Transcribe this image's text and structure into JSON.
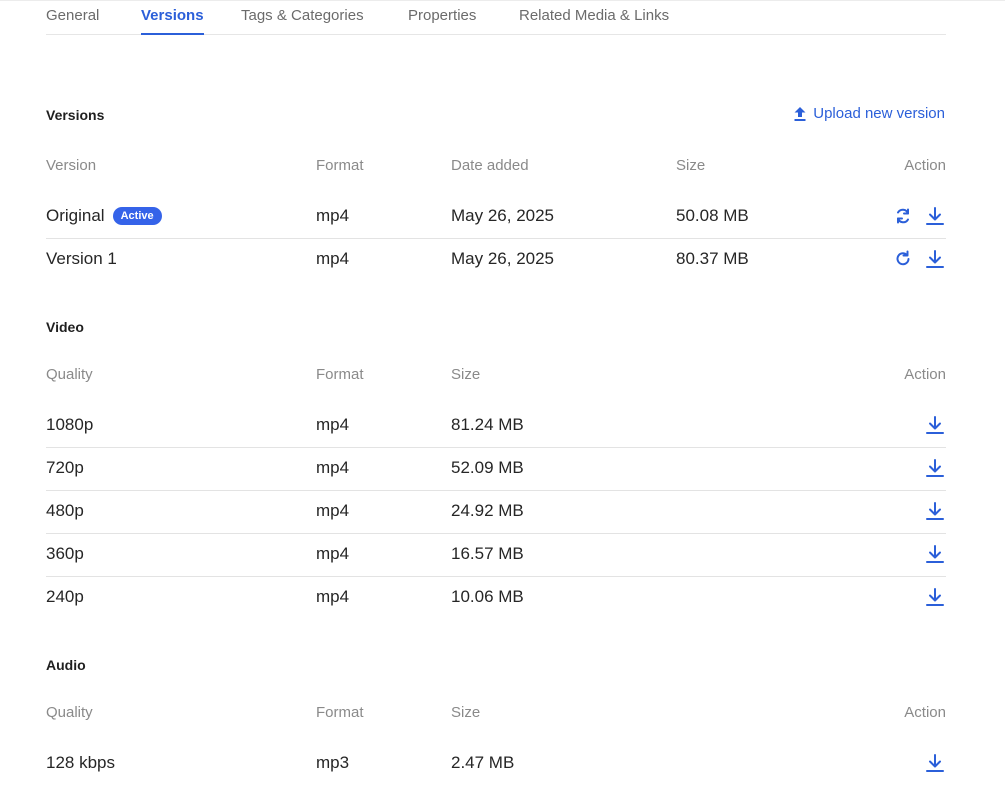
{
  "tabs": [
    "General",
    "Versions",
    "Tags & Categories",
    "Properties",
    "Related Media & Links"
  ],
  "active_tab": "Versions",
  "versions": {
    "title": "Versions",
    "upload_label": "Upload new version",
    "headers": {
      "version": "Version",
      "format": "Format",
      "date": "Date added",
      "size": "Size",
      "action": "Action"
    },
    "active_badge": "Active",
    "rows": [
      {
        "name": "Original",
        "format": "mp4",
        "date": "May 26, 2025",
        "size": "50.08 MB",
        "active": true
      },
      {
        "name": "Version 1",
        "format": "mp4",
        "date": "May 26, 2025",
        "size": "80.37 MB",
        "active": false
      }
    ]
  },
  "video": {
    "title": "Video",
    "headers": {
      "quality": "Quality",
      "format": "Format",
      "size": "Size",
      "action": "Action"
    },
    "rows": [
      {
        "quality": "1080p",
        "format": "mp4",
        "size": "81.24 MB"
      },
      {
        "quality": "720p",
        "format": "mp4",
        "size": "52.09 MB"
      },
      {
        "quality": "480p",
        "format": "mp4",
        "size": "24.92 MB"
      },
      {
        "quality": "360p",
        "format": "mp4",
        "size": "16.57 MB"
      },
      {
        "quality": "240p",
        "format": "mp4",
        "size": "10.06 MB"
      }
    ]
  },
  "audio": {
    "title": "Audio",
    "headers": {
      "quality": "Quality",
      "format": "Format",
      "size": "Size",
      "action": "Action"
    },
    "rows": [
      {
        "quality": "128 kbps",
        "format": "mp3",
        "size": "2.47 MB"
      }
    ]
  },
  "colors": {
    "accent": "#2b5fd9",
    "badge": "#3563e9"
  },
  "icons": {
    "upload": "upload-icon",
    "download": "download-icon",
    "sync": "sync-icon",
    "restore": "restore-icon"
  }
}
